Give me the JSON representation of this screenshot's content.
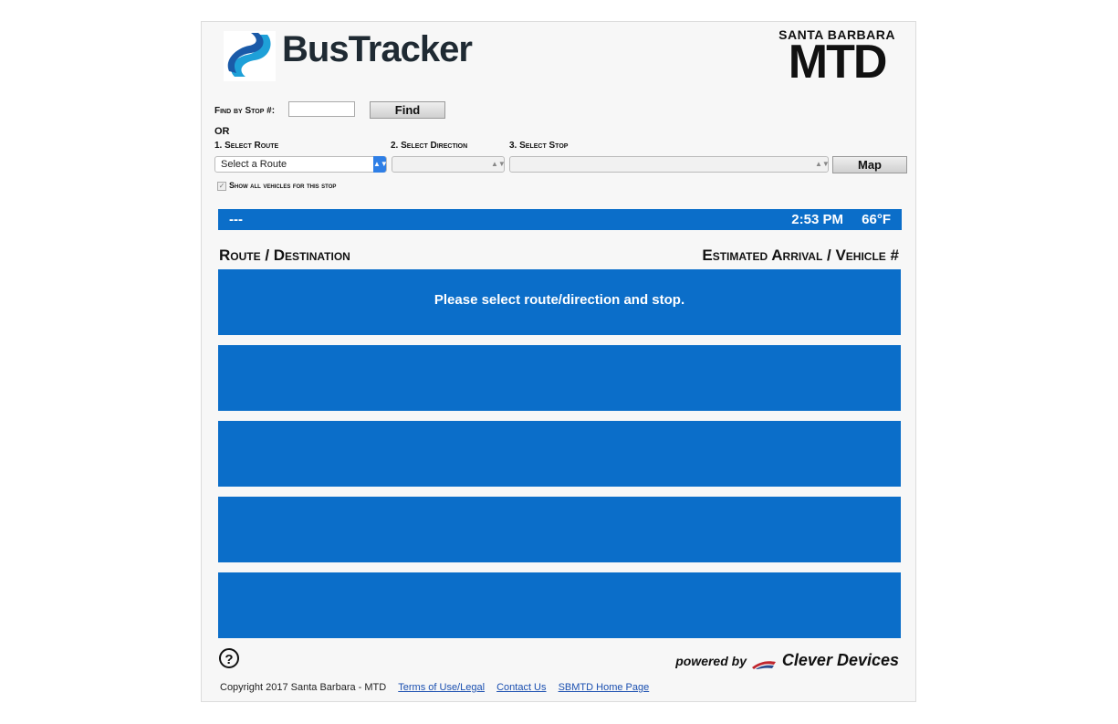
{
  "header": {
    "brand": "BusTracker",
    "agency_top": "SANTA BARBARA",
    "agency_big": "MTD"
  },
  "search": {
    "find_label": "Find by Stop #:",
    "find_button": "Find",
    "or_label": "OR"
  },
  "steps": {
    "route_label": "1. Select Route",
    "direction_label": "2. Select Direction",
    "stop_label": "3. Select Stop",
    "route_value": "Select a Route",
    "map_button": "Map"
  },
  "options": {
    "show_all_label": "Show all vehicles for this stop",
    "show_all_checked": true
  },
  "status": {
    "left": "---",
    "time": "2:53 PM",
    "temp": "66°F"
  },
  "table": {
    "col_left": "Route / Destination",
    "col_right": "Estimated Arrival / Vehicle #",
    "rows": [
      "Please select route/direction and stop.",
      "",
      "",
      "",
      ""
    ]
  },
  "footer": {
    "powered_prefix": "powered by",
    "powered_brand": "Clever Devices",
    "copyright": "Copyright 2017 Santa Barbara - MTD",
    "links": [
      "Terms of Use/Legal",
      "Contact Us",
      "SBMTD Home Page"
    ]
  },
  "colors": {
    "accent": "#0b6ec9",
    "select_blue": "#2f7fe6",
    "logo_dark": "#1f2a33"
  }
}
